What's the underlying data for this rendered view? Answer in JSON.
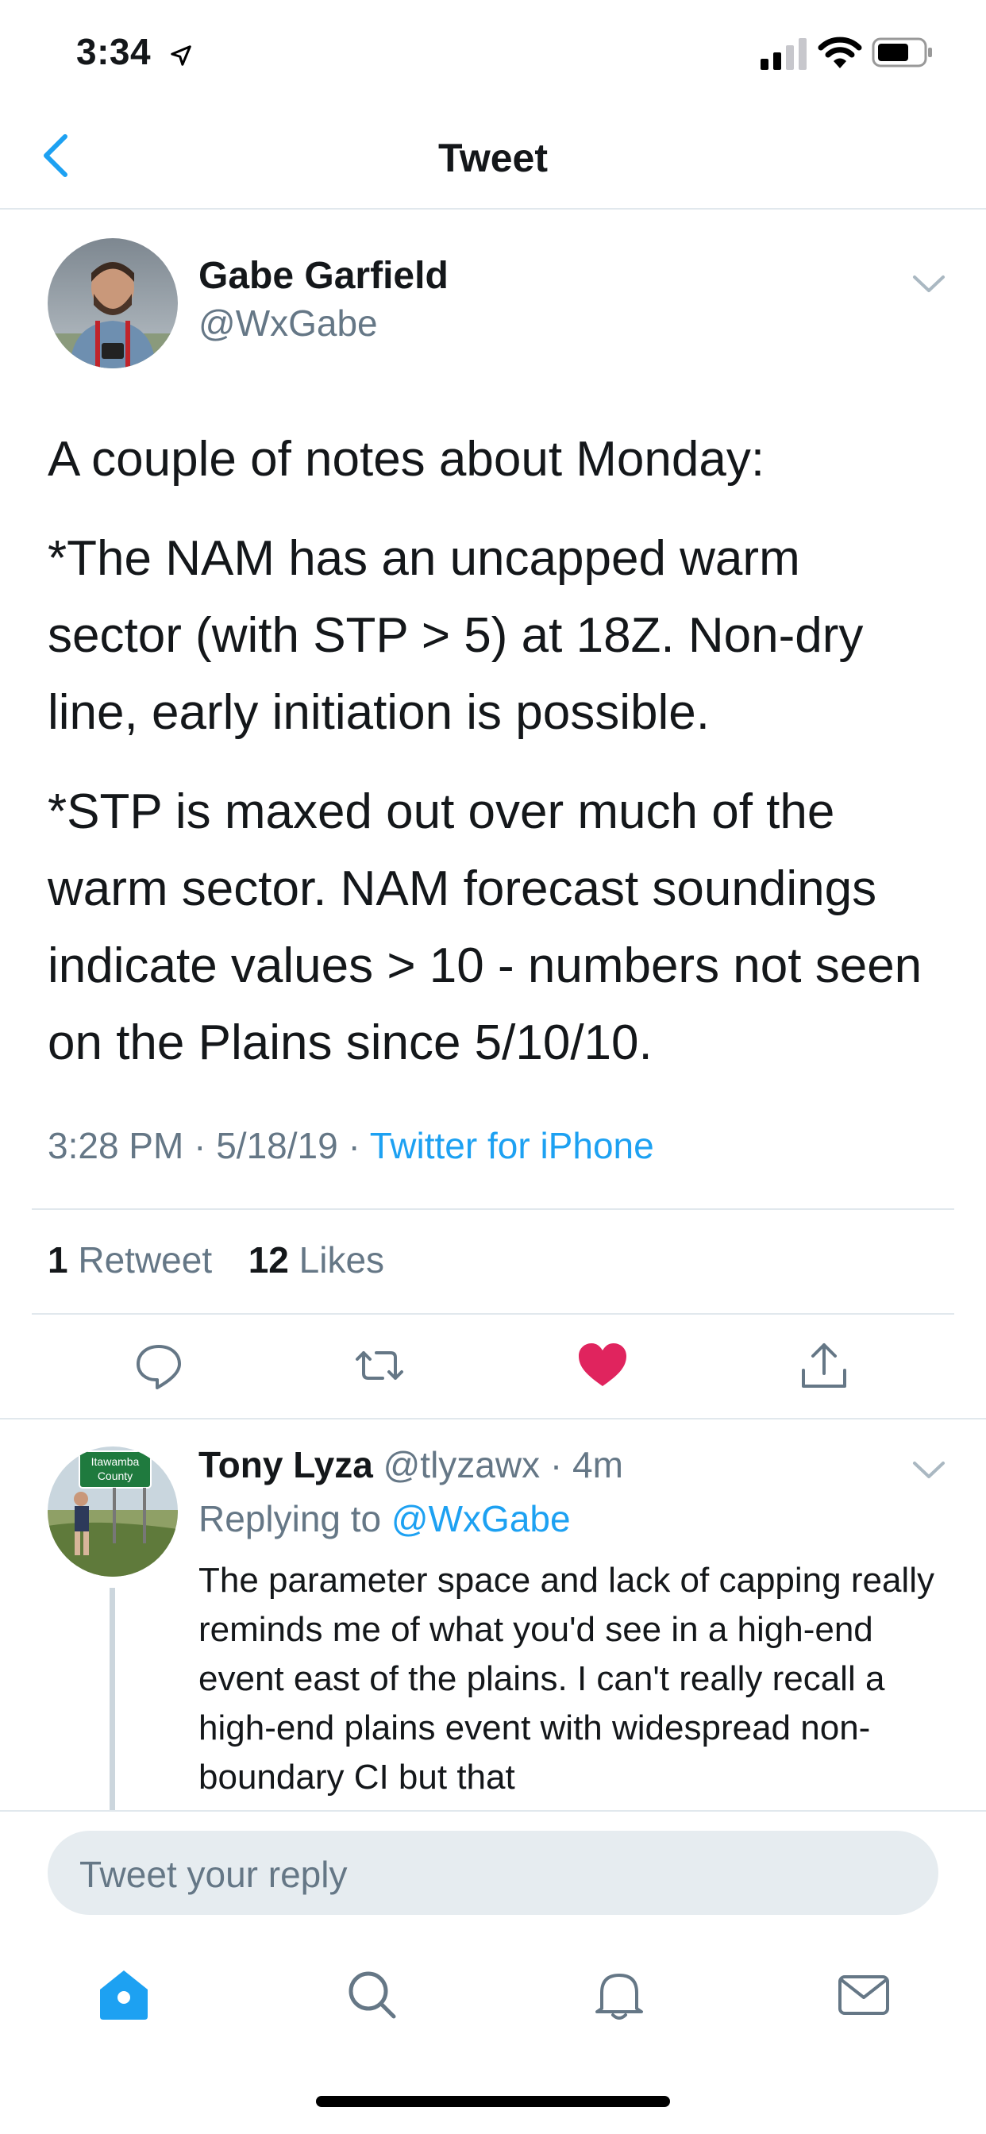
{
  "status_bar": {
    "time": "3:34"
  },
  "nav": {
    "title": "Tweet"
  },
  "tweet": {
    "author_name": "Gabe Garfield",
    "author_handle": "@WxGabe",
    "paragraphs": [
      "A couple of notes about Monday:",
      "*The NAM has an uncapped warm sector (with STP > 5) at 18Z.  Non-dry line, early initiation is possible.",
      "*STP is maxed out over much of the warm sector.  NAM forecast soundings indicate values > 10 - numbers not seen on the Plains since 5/10/10."
    ],
    "time": "3:28 PM",
    "date": "5/18/19",
    "source": "Twitter for iPhone",
    "retweet_count": "1",
    "retweet_label": "Retweet",
    "like_count": "12",
    "like_label": "Likes",
    "liked": true
  },
  "reply": {
    "author_name": "Tony Lyza",
    "author_handle": "@tlyzawx",
    "age": "4m",
    "replying_to_label": "Replying to",
    "replying_to_handle": "@WxGabe",
    "body": "The parameter space and lack of capping really reminds me of what you'd see in a high-end event east of the plains.  I can't really recall a high-end plains event with widespread non-boundary CI but that",
    "avatar_sign_line1": "Itawamba",
    "avatar_sign_line2": "County"
  },
  "composer": {
    "placeholder": "Tweet your reply"
  },
  "tab_bar": {
    "active": "home"
  },
  "colors": {
    "accent": "#1da1f2",
    "like": "#e0245e",
    "secondary_text": "#657786"
  }
}
